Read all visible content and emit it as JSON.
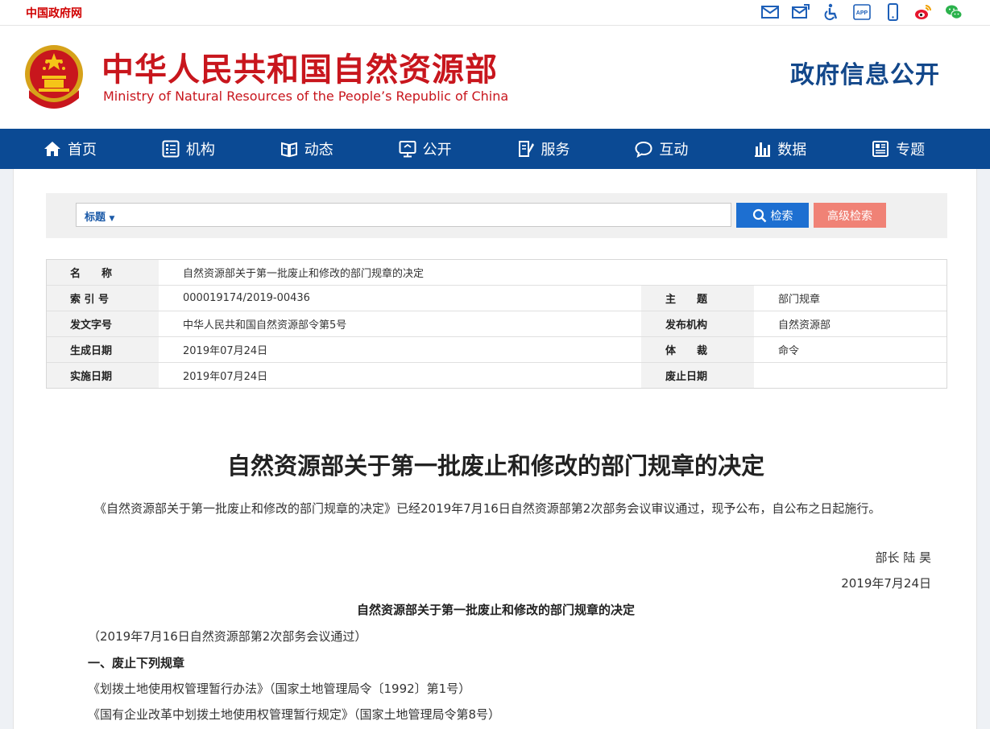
{
  "topbar": {
    "gov_link": "中国政府网",
    "icons": [
      "mail-icon",
      "mail-reply-icon",
      "accessibility-icon",
      "app-icon",
      "mobile-icon",
      "weibo-icon",
      "wechat-icon"
    ],
    "app_text": "APP"
  },
  "header": {
    "site_name_cn": "中华人民共和国自然资源部",
    "site_name_en": "Ministry of Natural Resources of the People’s Republic of China",
    "section_title": "政府信息公开"
  },
  "nav": {
    "items": [
      {
        "label": "首页",
        "icon": "home-icon"
      },
      {
        "label": "机构",
        "icon": "org-icon"
      },
      {
        "label": "动态",
        "icon": "news-icon"
      },
      {
        "label": "公开",
        "icon": "disclosure-icon"
      },
      {
        "label": "服务",
        "icon": "service-icon"
      },
      {
        "label": "互动",
        "icon": "chat-icon"
      },
      {
        "label": "数据",
        "icon": "chart-icon"
      },
      {
        "label": "专题",
        "icon": "topic-icon"
      }
    ]
  },
  "search": {
    "type_label": "标题",
    "value": "",
    "search_label": "检索",
    "advanced_label": "高级检索"
  },
  "meta": {
    "name_label": "名　　称",
    "name_value": "自然资源部关于第一批废止和修改的部门规章的决定",
    "index_label": "索 引 号",
    "index_value": "000019174/2019-00436",
    "theme_label": "主　　题",
    "theme_value": "部门规章",
    "docno_label": "发文字号",
    "docno_value": "中华人民共和国自然资源部令第5号",
    "publisher_label": "发布机构",
    "publisher_value": "自然资源部",
    "gendate_label": "生成日期",
    "gendate_value": "2019年07月24日",
    "genre_label": "体　　裁",
    "genre_value": "命令",
    "impldate_label": "实施日期",
    "impldate_value": "2019年07月24日",
    "abolish_label": "废止日期",
    "abolish_value": ""
  },
  "article": {
    "title": "自然资源部关于第一批废止和修改的部门规章的决定",
    "intro": "《自然资源部关于第一批废止和修改的部门规章的决定》已经2019年7月16日自然资源部第2次部务会议审议通过，现予公布，自公布之日起施行。",
    "signer": "部长 陆 昊",
    "sign_date": "2019年7月24日",
    "subtitle": "自然资源部关于第一批废止和修改的部门规章的决定",
    "adopted": "（2019年7月16日自然资源部第2次部务会议通过）",
    "section1": "一、废止下列规章",
    "item1": "《划拨土地使用权管理暂行办法》（国家土地管理局令〔1992〕第1号）",
    "item2": "《国有企业改革中划拨土地使用权管理暂行规定》（国家土地管理局令第8号）"
  },
  "colors": {
    "nav_bg": "#0b4a94",
    "brand_red": "#c8161d",
    "section_blue": "#12478a",
    "search_btn": "#1d6fd1",
    "adv_btn": "#f08276"
  }
}
